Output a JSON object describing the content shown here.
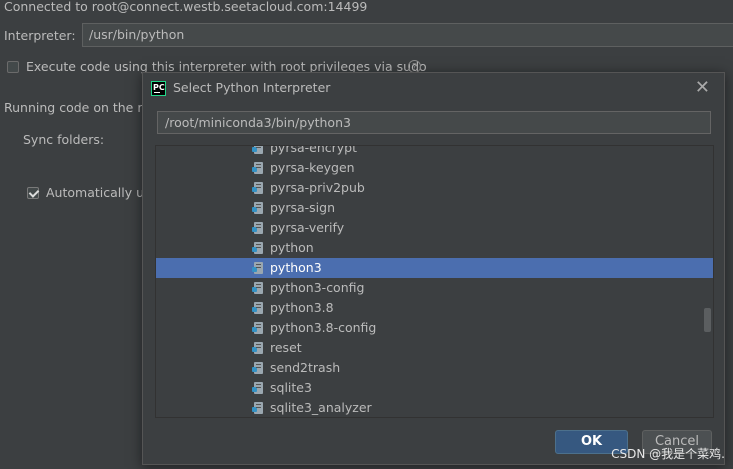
{
  "background": {
    "connected_text": "Connected to root@connect.westb.seetacloud.com:14499",
    "interpreter_label": "Interpreter:",
    "interpreter_value": "/usr/bin/python",
    "sudo_checkbox_label": "Execute code using this interpreter with root privileges via sudo",
    "running_code_text": "Running code on the re",
    "sync_folders_label": "Sync folders:",
    "auto_upload_label": "Automatically up"
  },
  "dialog": {
    "title": "Select Python Interpreter",
    "path_value": "/root/miniconda3/bin/python3",
    "files": [
      "pyrsa-encrypt",
      "pyrsa-keygen",
      "pyrsa-priv2pub",
      "pyrsa-sign",
      "pyrsa-verify",
      "python",
      "python3",
      "python3-config",
      "python3.8",
      "python3.8-config",
      "reset",
      "send2trash",
      "sqlite3",
      "sqlite3_analyzer"
    ],
    "selected_file": "python3",
    "ok_label": "OK",
    "cancel_label": "Cancel"
  },
  "watermark": "CSDN @我是个菜鸡.",
  "colors": {
    "selection": "#4b6eaf",
    "ok_button": "#365880",
    "background": "#3c3f41"
  }
}
